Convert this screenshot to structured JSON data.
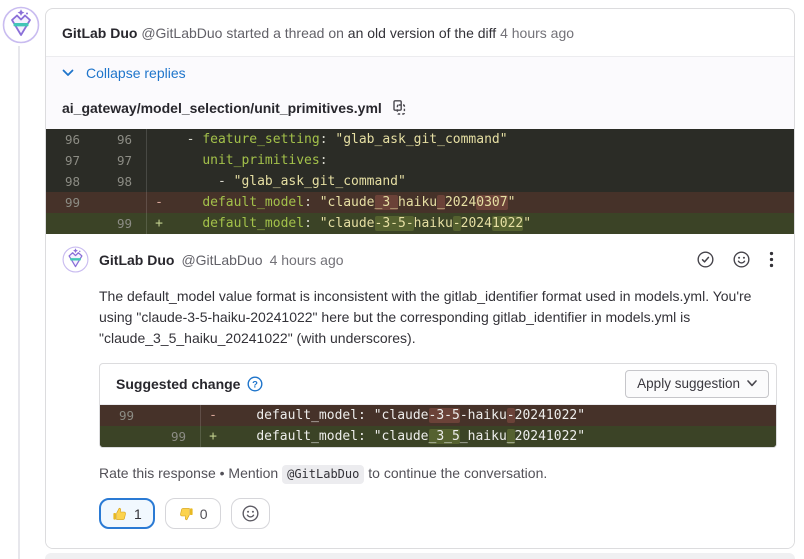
{
  "thread": {
    "author": "GitLab Duo",
    "handle": "@GitLabDuo",
    "action": "started a thread on",
    "target_link": "an old version of the diff",
    "time": "4 hours ago",
    "collapse_label": "Collapse replies",
    "file_path": "ai_gateway/model_selection/unit_primitives.yml"
  },
  "code_diff": {
    "rows": [
      {
        "old": "96",
        "new": "96",
        "marker": "",
        "type": "context",
        "segments": [
          {
            "t": "  - ",
            "c": "punct"
          },
          {
            "t": "feature_setting",
            "c": "key"
          },
          {
            "t": ": ",
            "c": "punct"
          },
          {
            "t": "\"glab_ask_git_command\"",
            "c": "str"
          }
        ]
      },
      {
        "old": "97",
        "new": "97",
        "marker": "",
        "type": "context",
        "segments": [
          {
            "t": "    ",
            "c": "punct"
          },
          {
            "t": "unit_primitives",
            "c": "key"
          },
          {
            "t": ":",
            "c": "punct"
          }
        ]
      },
      {
        "old": "98",
        "new": "98",
        "marker": "",
        "type": "context",
        "segments": [
          {
            "t": "      - ",
            "c": "punct"
          },
          {
            "t": "\"glab_ask_git_command\"",
            "c": "str"
          }
        ]
      },
      {
        "old": "99",
        "new": "",
        "marker": "-",
        "type": "removed",
        "segments": [
          {
            "t": "    ",
            "c": "punct"
          },
          {
            "t": "default_model",
            "c": "key"
          },
          {
            "t": ": ",
            "c": "punct"
          },
          {
            "t": "\"claude",
            "c": "str"
          },
          {
            "t": "_3_",
            "c": "str",
            "hl": "del"
          },
          {
            "t": "haiku",
            "c": "str"
          },
          {
            "t": "_",
            "c": "str",
            "hl": "del"
          },
          {
            "t": "2024",
            "c": "str"
          },
          {
            "t": "0307",
            "c": "str",
            "hl": "del"
          },
          {
            "t": "\"",
            "c": "str"
          }
        ]
      },
      {
        "old": "",
        "new": "99",
        "marker": "+",
        "type": "added",
        "segments": [
          {
            "t": "    ",
            "c": "punct"
          },
          {
            "t": "default_model",
            "c": "key"
          },
          {
            "t": ": ",
            "c": "punct"
          },
          {
            "t": "\"claude",
            "c": "str"
          },
          {
            "t": "-3-5-",
            "c": "str",
            "hl": "add"
          },
          {
            "t": "haiku",
            "c": "str"
          },
          {
            "t": "-",
            "c": "str",
            "hl": "add"
          },
          {
            "t": "2024",
            "c": "str"
          },
          {
            "t": "1022",
            "c": "str",
            "hl": "add"
          },
          {
            "t": "\"",
            "c": "str"
          }
        ]
      }
    ]
  },
  "comment": {
    "author": "GitLab Duo",
    "handle": "@GitLabDuo",
    "time": "4 hours ago",
    "body": "The default_model value format is inconsistent with the gitlab_identifier format used in models.yml. You're using \"claude-3-5-haiku-20241022\" here but the corresponding gitlab_identifier in models.yml is \"claude_3_5_haiku_20241022\" (with underscores)."
  },
  "suggestion": {
    "title": "Suggested change",
    "apply_label": "Apply suggestion",
    "rows": [
      {
        "old": "99",
        "new": "",
        "marker": "-",
        "type": "removed",
        "segments": [
          {
            "t": "    ",
            "c": "plain"
          },
          {
            "t": "default_model: ",
            "c": "plain"
          },
          {
            "t": "\"claude",
            "c": "plain"
          },
          {
            "t": "-3-5",
            "c": "plain",
            "hl": "del"
          },
          {
            "t": "-haiku",
            "c": "plain"
          },
          {
            "t": "-",
            "c": "plain",
            "hl": "del"
          },
          {
            "t": "20241022\"",
            "c": "plain"
          }
        ]
      },
      {
        "old": "",
        "new": "99",
        "marker": "+",
        "type": "added",
        "segments": [
          {
            "t": "    ",
            "c": "plain"
          },
          {
            "t": "default_model: ",
            "c": "plain"
          },
          {
            "t": "\"claude",
            "c": "plain"
          },
          {
            "t": "_3_5",
            "c": "plain",
            "hl": "add"
          },
          {
            "t": "_haiku",
            "c": "plain"
          },
          {
            "t": "_",
            "c": "plain",
            "hl": "add"
          },
          {
            "t": "20241022\"",
            "c": "plain"
          }
        ]
      }
    ]
  },
  "footer": {
    "rate_prefix": "Rate this response • Mention",
    "mention_code": "@GitLabDuo",
    "rate_suffix": "to continue the conversation.",
    "thumbs_up_count": "1",
    "thumbs_down_count": "0"
  },
  "icons": {
    "avatar": "gitlab-duo-logo",
    "collapse_chevron": "chevron-down",
    "copy": "copy-to-clipboard",
    "resolve": "check-circle",
    "reaction": "smiley-face",
    "more": "vertical-ellipsis",
    "help": "question-mark-circle",
    "apply_chevron": "chevron-down",
    "thumbs_up": "thumbs-up-emoji",
    "thumbs_down": "thumbs-down-emoji",
    "add_reaction": "smiley-face"
  },
  "colors": {
    "accent_blue": "#1f75cb",
    "code_bg": "#2b2c26",
    "diff_removed_bg": "#463229",
    "diff_added_bg": "#3b4326",
    "diff_removed_highlight": "#6b4238",
    "diff_added_highlight": "#55612f",
    "yaml_key": "#a3c14a",
    "yaml_string": "#e6dfa3",
    "selected_award_border": "#2a7ad4"
  }
}
